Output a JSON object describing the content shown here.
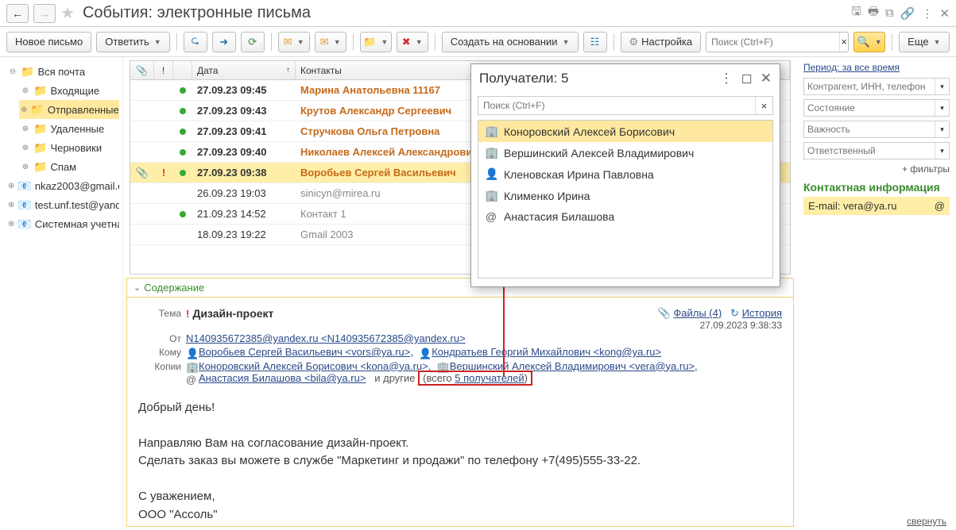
{
  "header": {
    "title": "События: электронные письма"
  },
  "toolbar": {
    "new_mail": "Новое письмо",
    "reply": "Ответить",
    "create_based": "Создать на основании",
    "settings": "Настройка",
    "search_placeholder": "Поиск (Ctrl+F)",
    "more": "Еще"
  },
  "tree": {
    "all_mail": "Вся почта",
    "inbox": "Входящие",
    "sent": "Отправленные",
    "deleted": "Удаленные",
    "drafts": "Черновики",
    "spam": "Спам",
    "acc1": "nkaz2003@gmail.com",
    "acc2": "test.unf.test@yandex.ru",
    "acc3": "Системная учетная запись"
  },
  "grid": {
    "h_date": "Дата",
    "h_contact": "Контакты",
    "rows": [
      {
        "att": "",
        "imp": "",
        "st": true,
        "date": "27.09.23 09:45",
        "contact": "Марина Анатольевна 11167"
      },
      {
        "att": "",
        "imp": "",
        "st": true,
        "date": "27.09.23 09:43",
        "contact": "Крутов Александр Сергеевич"
      },
      {
        "att": "",
        "imp": "",
        "st": true,
        "date": "27.09.23 09:41",
        "contact": "Стручкова Ольга Петровна"
      },
      {
        "att": "",
        "imp": "",
        "st": true,
        "date": "27.09.23 09:40",
        "contact": "Николаев Алексей Александрович"
      },
      {
        "att": "📎",
        "imp": "!",
        "st": true,
        "date": "27.09.23 09:38",
        "contact": "Воробьев Сергей Васильевич"
      },
      {
        "att": "",
        "imp": "",
        "st": false,
        "date": "26.09.23 19:03",
        "contact": "sinicyn@mirea.ru <sinicyn@mirea.ru>"
      },
      {
        "att": "",
        "imp": "",
        "st": true,
        "date": "21.09.23 14:52",
        "contact": "Контакт 1 <n140935672385@yandex.ru>"
      },
      {
        "att": "",
        "imp": "",
        "st": false,
        "date": "18.09.23 19:22",
        "contact": "Gmail 2003 <nkaz2003@gmail.com>"
      }
    ],
    "selected_index": 4,
    "older_indices": [
      5,
      6,
      7
    ]
  },
  "right": {
    "period": "Период: за все время",
    "f_contr": "Контрагент, ИНН, телефон",
    "f_state": "Состояние",
    "f_imp": "Важность",
    "f_resp": "Ответственный",
    "more_filters": "+ фильтры",
    "ci_title": "Контактная информация",
    "ci_label": "E-mail: vera@ya.ru",
    "ci_badge": "@"
  },
  "content": {
    "section_label": "Содержание",
    "subject_label": "Тема",
    "from_label": "От",
    "to_label": "Кому",
    "cc_label": "Копии",
    "subject": "Дизайн-проект",
    "from": "N140935672385@yandex.ru <N140935672385@yandex.ru>",
    "to1": "Воробьев Сергей Васильевич <vors@ya.ru>,",
    "to2": "Кондратьев Георгий Михайлович <kong@ya.ru>",
    "cc1": "Коноровский Алексей Борисович <kona@ya.ru>,",
    "cc2": "Вершинский Алексей Владимирович <vera@ya.ru>,",
    "cc3": "Анастасия Билашова <bila@ya.ru>",
    "others_text": "и другие",
    "others_total_prefix": "(всего ",
    "others_link": "5 получателей",
    "others_total_suffix": ")",
    "files_label": "Файлы (4)",
    "history_label": "История",
    "timestamp": "27.09.2023 9:38:33",
    "body_greeting": "Добрый день!",
    "body_l1": "Направляю Вам на согласование дизайн-проект.",
    "body_l2": "Сделать заказ вы можете в службе \"Маркетинг и продажи\" по телефону +7(495)555-33-22.",
    "body_sig1": "С уважением,",
    "body_sig2": "ООО \"Ассоль\"",
    "collapse": "свернуть"
  },
  "popup": {
    "title": "Получатели: 5",
    "search_placeholder": "Поиск (Ctrl+F)",
    "items": [
      {
        "ico": "org",
        "text": "Коноровский Алексей Борисович <kona@ya.ru>"
      },
      {
        "ico": "org",
        "text": "Вершинский Алексей Владимирович <vera@ya.ru>"
      },
      {
        "ico": "person",
        "text": "Кленовская Ирина Павловна <klei@ya.ru>"
      },
      {
        "ico": "org",
        "text": "Клименко Ирина <klii@ya.ru>"
      },
      {
        "ico": "at",
        "text": "Анастасия Билашова <bila@ya.ru>"
      }
    ],
    "selected_index": 0
  }
}
